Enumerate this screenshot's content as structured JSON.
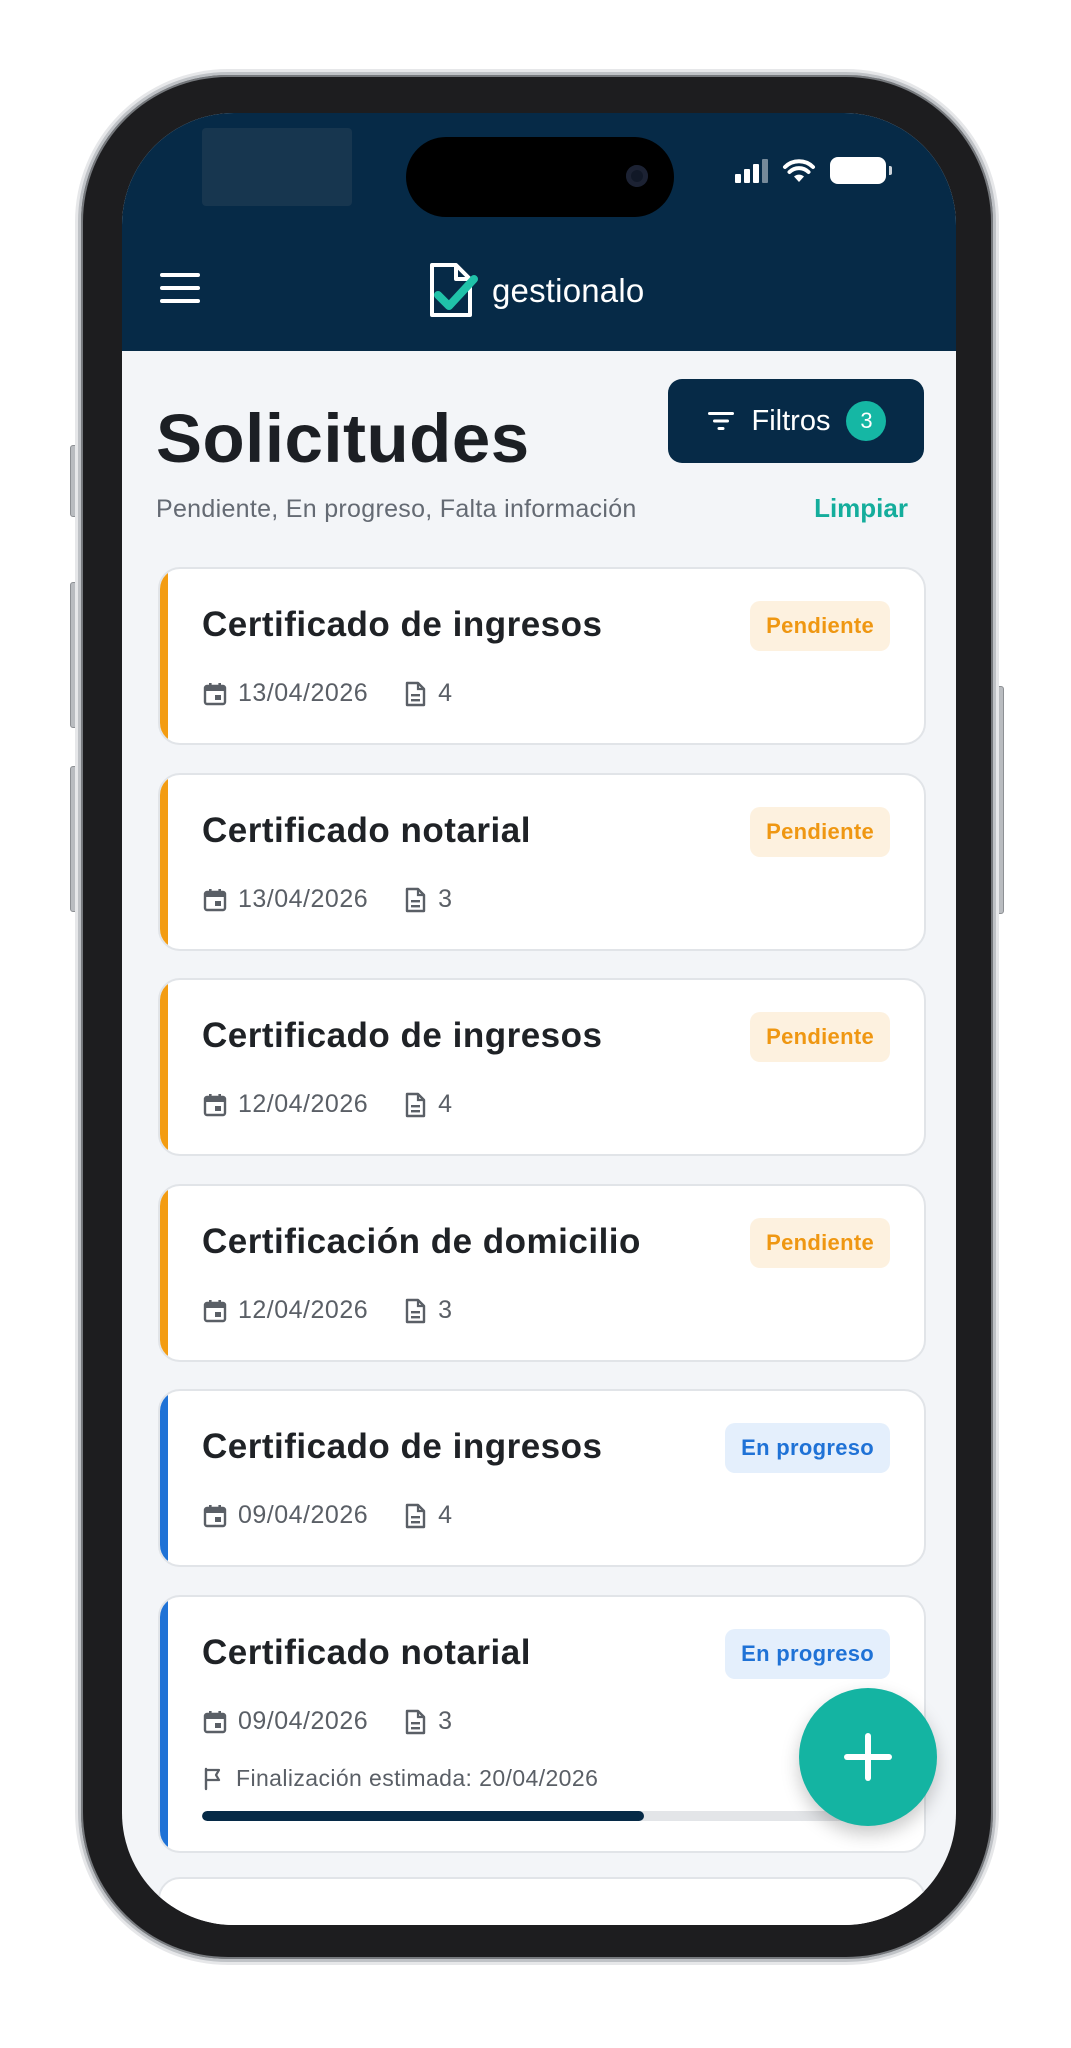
{
  "status_bar": {
    "icons": [
      "signal-icon",
      "wifi-icon",
      "battery-icon"
    ]
  },
  "header": {
    "menu_icon": "menu-icon",
    "brand_name": "gestionalo",
    "logo_icon": "document-check-logo"
  },
  "page": {
    "title": "Solicitudes",
    "filter_button": {
      "label": "Filtros",
      "count": "3",
      "icon": "filter-icon"
    },
    "active_filters": "Pendiente, En progreso, Falta información",
    "clear_label": "Limpiar"
  },
  "requests": [
    {
      "title": "Certificado de ingresos",
      "status": "Pendiente",
      "date": "13/04/2026",
      "docs": "4"
    },
    {
      "title": "Certificado notarial",
      "status": "Pendiente",
      "date": "13/04/2026",
      "docs": "3"
    },
    {
      "title": "Certificado de ingresos",
      "status": "Pendiente",
      "date": "12/04/2026",
      "docs": "4"
    },
    {
      "title": "Certificación de domicilio",
      "status": "Pendiente",
      "date": "12/04/2026",
      "docs": "3"
    },
    {
      "title": "Certificado de ingresos",
      "status": "En progreso",
      "date": "09/04/2026",
      "docs": "4"
    },
    {
      "title": "Certificado notarial",
      "status": "En progreso",
      "date": "09/04/2026",
      "docs": "3",
      "eta": "Finalización estimada: 20/04/2026",
      "progress_percent": 64
    }
  ],
  "fab": {
    "icon": "plus-icon"
  },
  "colors": {
    "primary": "#062a47",
    "accent": "#14b4a2",
    "pending": "#f39c12",
    "in_progress": "#1f72d6"
  }
}
